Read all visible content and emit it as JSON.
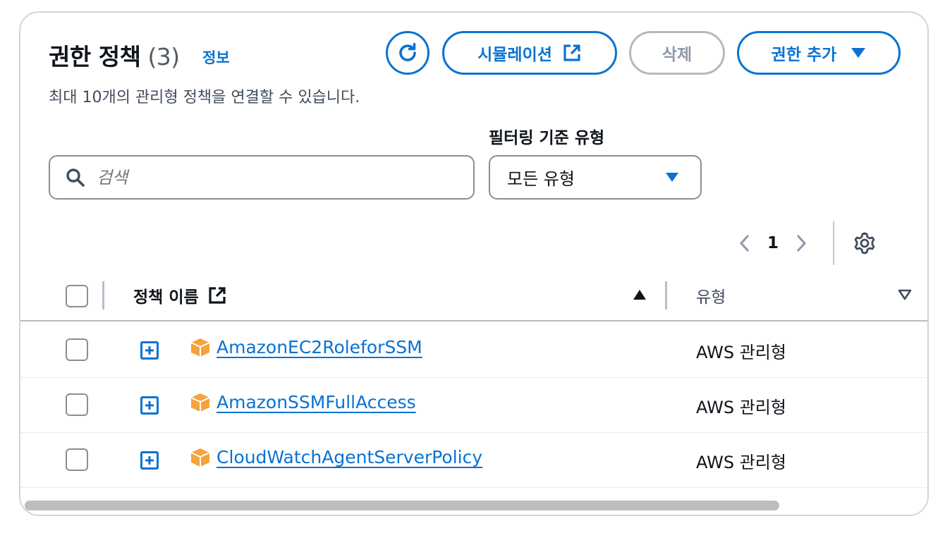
{
  "header": {
    "title": "권한 정책",
    "count": "(3)",
    "info_link": "정보",
    "description": "최대 10개의 관리형 정책을 연결할 수 있습니다."
  },
  "toolbar": {
    "refresh_icon": "refresh-icon",
    "simulation_label": "시뮬레이션",
    "delete_label": "삭제",
    "add_permission_label": "권한 추가"
  },
  "filter": {
    "label": "필터링 기준 유형",
    "search_placeholder": "검색",
    "type_selected": "모든 유형"
  },
  "pagination": {
    "current_page": "1"
  },
  "table": {
    "columns": {
      "policy_name": "정책 이름",
      "type": "유형"
    },
    "rows": [
      {
        "name": "AmazonEC2RoleforSSM",
        "type": "AWS 관리형"
      },
      {
        "name": "AmazonSSMFullAccess",
        "type": "AWS 관리형"
      },
      {
        "name": "CloudWatchAgentServerPolicy",
        "type": "AWS 관리형"
      }
    ]
  },
  "colors": {
    "accent": "#0972d3",
    "disabled": "#b4b9c0",
    "text": "#0f141a",
    "policy_icon": "#f5a33a"
  }
}
